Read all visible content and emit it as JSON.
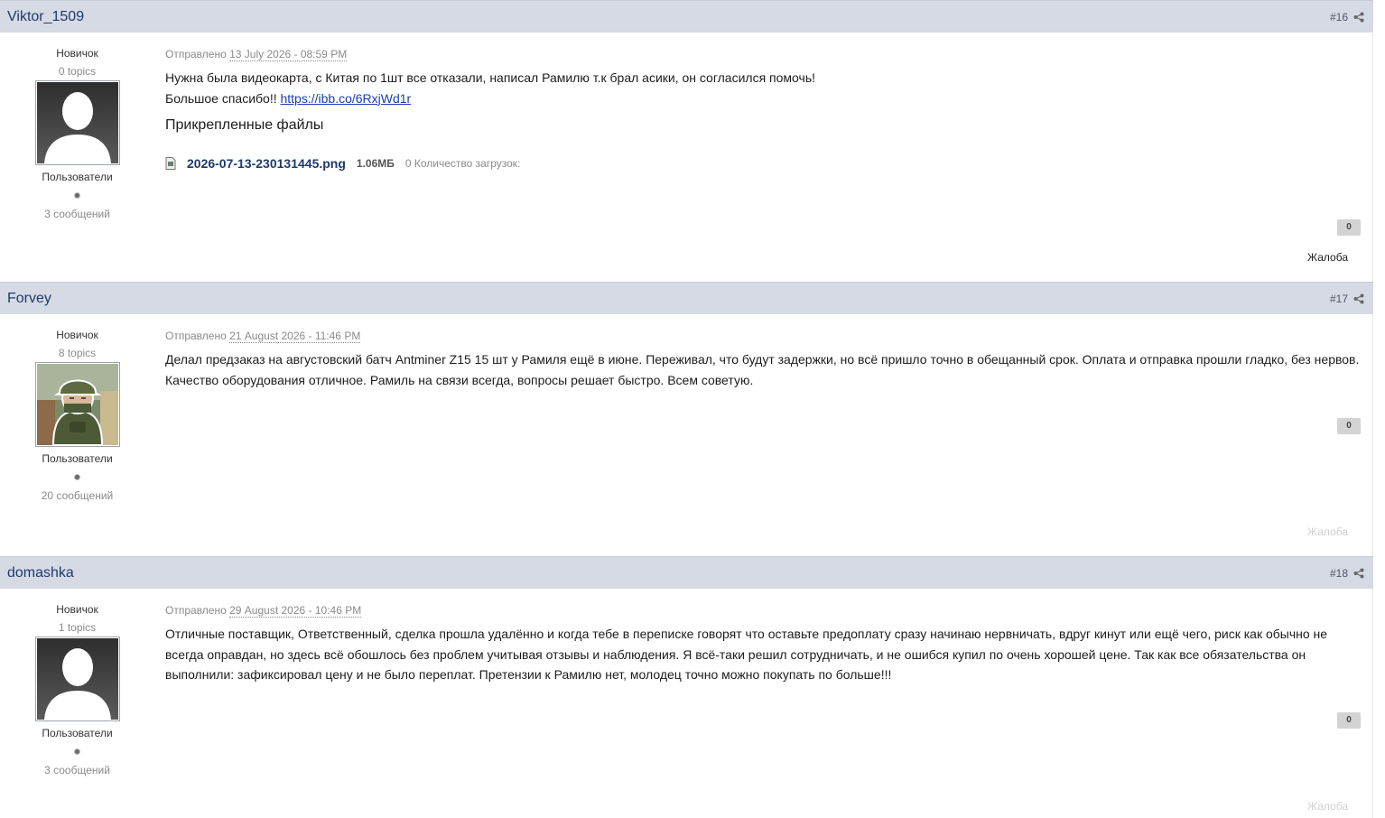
{
  "labels": {
    "posted_prefix": "Отправлено",
    "rank": "Новичок",
    "group": "Пользователи",
    "report": "Жалоба"
  },
  "posts": [
    {
      "author": "Viktor_1509",
      "number": "#16",
      "topics": "0 topics",
      "posts_count": "3 сообщений",
      "date": "13 July 2026 - 08:59 PM",
      "text_line1": "Нужна была видеокарта, с Китая по 1шт все отказали, написал Рамилю т.к брал асики, он согласился помочь!",
      "text_line2_prefix": "Большое спасибо!! ",
      "link": "https://ibb.co/6RxjWd1r",
      "attachments_title": "Прикрепленные файлы",
      "attachment": {
        "name": "2026-07-13-230131445.png",
        "size": "1.06МБ",
        "downloads": "0 Количество загрузок:"
      },
      "reputation": "0"
    },
    {
      "author": "Forvey",
      "number": "#17",
      "topics": "8 topics",
      "posts_count": "20 сообщений",
      "date": "21 August 2026 - 11:46 PM",
      "text": "Делал предзаказ на августовский батч Antminer Z15 15 шт у Рамиля ещё в июне. Переживал, что будут задержки, но всё пришло точно в обещанный срок. Оплата и отправка прошли гладко, без нервов. Качество оборудования отличное. Рамиль на связи всегда, вопросы решает быстро. Всем советую.",
      "reputation": "0"
    },
    {
      "author": "domashka",
      "number": "#18",
      "topics": "1 topics",
      "posts_count": "3 сообщений",
      "date": "29 August 2026 - 10:46 PM",
      "text": "Отличные поставщик, Ответственный, сделка прошла удалённо и когда тебе в переписке говорят что оставьте предоплату сразу начинаю нервничать, вдруг кинут или ещё чего, риск как обычно не всегда оправдан, но здесь всё обошлось без проблем учитывая отзывы и наблюдения. Я всё-таки решил сотрудничать, и не ошибся купил по очень хорошей цене. Так как все обязательства он выполнили: зафиксировал цену и не было переплат. Претензии к Рамилю нет, молодец точно можно покупать по больше!!!",
      "reputation": "0"
    }
  ]
}
